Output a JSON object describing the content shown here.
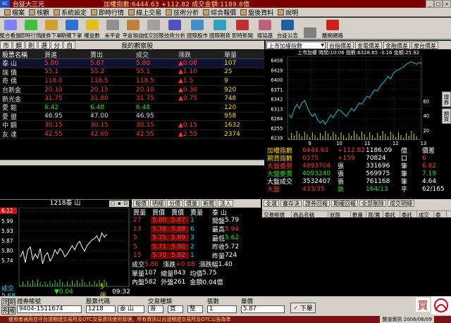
{
  "window": {
    "app": "台証大三元",
    "ticker": "加權指數:6444.63 +112.82 成交金額:1189.8億"
  },
  "menu": [
    "檔案",
    "核觀",
    "系統設定",
    "即時行情",
    "線上交易",
    "技術分析",
    "綜合報價",
    "盤後資料",
    "說明"
  ],
  "toolbar": [
    "整合看盤",
    "即時行情",
    "證券下單",
    "期權下單",
    "權益數",
    "未平倉",
    "平倉損益",
    "成交回報",
    "技術分析",
    "國際股市",
    "國際期貨",
    "即時新聞",
    "導協基",
    "台証公告",
    "",
    "離開網路"
  ],
  "watch_tabs": [
    "市",
    "類",
    "則",
    "選",
    "分",
    "自"
  ],
  "watch_title": "我的觀察股",
  "watch_headers": [
    "股票名稱",
    "買進",
    "賣出",
    "成交",
    "漲跌",
    "單量"
  ],
  "watch_rows": [
    {
      "name": "泰 山",
      "bid": "5.80",
      "ask": "5.87",
      "last": "5.80",
      "chg": "▲0.08",
      "vol": "107",
      "c": "red"
    },
    {
      "name": "瑞 儀",
      "bid": "55.1",
      "ask": "55.2",
      "last": "55.1",
      "chg": "▲1.10",
      "vol": "25",
      "c": "red"
    },
    {
      "name": "奇 偶",
      "bid": "118.0",
      "ask": "118.5",
      "last": "118.5",
      "chg": "▲1.5",
      "vol": "9",
      "c": "red"
    },
    {
      "name": "台新金",
      "bid": "20.10",
      "ask": "20.15",
      "last": "20.10",
      "chg": "▲0.30",
      "vol": "920",
      "c": "red"
    },
    {
      "name": "新光金",
      "bid": "31.75",
      "ask": "31.80",
      "last": "31.75",
      "chg": "▲0.75",
      "vol": "748",
      "c": "red"
    },
    {
      "name": "愛 能",
      "bid": "6.42",
      "ask": "6.48",
      "last": "6.48",
      "chg": "",
      "vol": "120",
      "c": "grn"
    },
    {
      "name": "愛 盟",
      "bid": "46.95",
      "ask": "47.00",
      "last": "46.95",
      "chg": "",
      "vol": "958",
      "c": "wht"
    },
    {
      "name": "中 鋼",
      "bid": "30.15",
      "ask": "30.15",
      "last": "30.15",
      "chg": "▲0.15",
      "vol": "1632",
      "c": "red"
    },
    {
      "name": "友 達",
      "bid": "42.55",
      "ask": "42.60",
      "last": "42.55",
      "chg": "▲2.55",
      "vol": "2374",
      "c": "red"
    }
  ],
  "index_panel": {
    "selected": "上市加權指數",
    "buttons": [
      "台指價差",
      "金電價差",
      "金融價差",
      "摩台價差"
    ],
    "header": "上市加權 時間:10:06 指數:6328.65 -3.16 金額:25.92",
    "yticks": [
      "6458",
      "6429",
      "6400",
      "6371",
      "6342",
      "6313",
      "6284",
      "6255",
      "6239"
    ],
    "vol_ticks": [
      "60",
      "40",
      "20"
    ],
    "xticks": [
      "9",
      "10",
      "11",
      "12",
      "13"
    ]
  },
  "index_rows": [
    {
      "a": "加權指數",
      "b": "6444.63",
      "c": "+112.82",
      "d": "1186.09",
      "e": "億",
      "f": "價差"
    },
    {
      "a": "期貨指數",
      "b": "6375",
      "c": "+159",
      "d": "70824",
      "e": "口",
      "f": "6"
    },
    {
      "a": "大盤委買",
      "b": "4993704",
      "c": "張",
      "d": "331696",
      "e": "筆",
      "f": "6.82"
    },
    {
      "a": "大盤委賣",
      "b": "4093240",
      "c": "張",
      "d": "569975",
      "e": "筆",
      "f": "7.19"
    },
    {
      "a": "大盤成交",
      "b": "3532407",
      "c": "張",
      "d": "761168",
      "e": "筆",
      "f": "4.64"
    },
    {
      "a": "大盤",
      "b": "433/35",
      "c": "跌",
      "d": "164/13",
      "e": "平",
      "f": "62/165"
    }
  ],
  "side_tabs": [
    "證券",
    "期貨"
  ],
  "stock": {
    "title": "1218泰 山",
    "yticks": [
      "6.12",
      "5.99",
      "5.93",
      "5.87",
      "5.80",
      "5.74"
    ],
    "vol": "成交5.68",
    "chg": "▼0.04",
    "sz": "5張",
    "time": "09:32"
  },
  "book_tabs": [
    "報價",
    "明細",
    "分價",
    "價量",
    "新聞",
    "法人"
  ],
  "book_headers": [
    "買量",
    "買價",
    "賣價",
    "賣量"
  ],
  "book": {
    "stock": "泰 山",
    "rows": [
      {
        "bq": "27",
        "bp": "5.80",
        "sp": "5.87",
        "sq": "1",
        "k": "開盤",
        "v": "5.79"
      },
      {
        "bq": "13",
        "bp": "5.78",
        "sp": "5.88",
        "sq": "6",
        "k": "最高",
        "v": "5.94"
      },
      {
        "bq": "5",
        "bp": "5.75",
        "sp": "5.89",
        "sq": "3",
        "k": "最低",
        "v": "5.62"
      },
      {
        "bq": "5",
        "bp": "5.71",
        "sp": "5.90",
        "sq": "2",
        "k": "昨收",
        "v": "5.72"
      },
      {
        "bq": "15",
        "bp": "5.70",
        "sp": "5.92",
        "sq": "1",
        "k": "昨量",
        "v": "724"
      }
    ],
    "summary": [
      {
        "k": "成交",
        "v": "5.80",
        "k2": "漲跌",
        "v2": "+0.08",
        "k3": "漲跌幅",
        "v3": "1.40"
      },
      {
        "k": "單量",
        "v": "107",
        "k2": "總量",
        "v2": "843",
        "k3": "均價",
        "v3": "5.75"
      },
      {
        "k": "內盤",
        "v": "582",
        "k2": "外盤",
        "v2": "261",
        "k3": "金額",
        "v3": "0.04億"
      }
    ]
  },
  "trades_tools": [
    "全選",
    "審存決",
    "證券回報",
    "期權回報",
    "全部刪除",
    "成交明細"
  ],
  "trades_headers": [
    "交易帳號",
    "商品名稱",
    "狀態",
    "數量",
    "買/賣",
    "委託價",
    "委託量",
    "成交量",
    "委"
  ],
  "order": {
    "labels": [
      "證券帳號",
      "股票代碼",
      "交易種類",
      "張數",
      "單價"
    ],
    "account": "9404-1511674",
    "code": "1218",
    "name": "泰 山",
    "kind": "普",
    "side": "買",
    "lot": "整",
    "qty": "1",
    "price": "5.87",
    "submit": "下單",
    "buy": "買",
    "left_btns": [
      "證",
      "期",
      "券",
      "權"
    ]
  },
  "status_text": "使用者適用並守台證期證交易所及OTC交易資訊使用管理，所有資訊以台證期證交易所及OTC公告為準",
  "status_right": "聲道資訊 2006/06/09"
}
